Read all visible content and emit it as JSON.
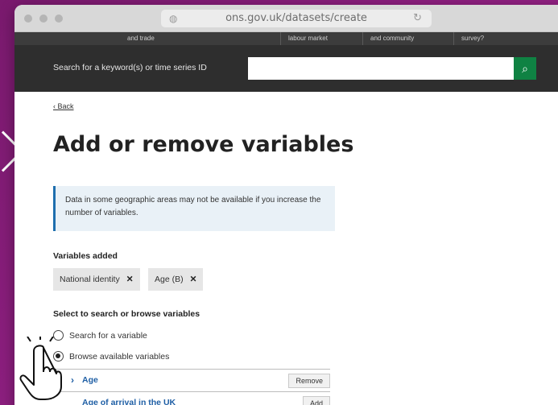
{
  "browser": {
    "url": "ons.gov.uk/datasets/create"
  },
  "topnav": {
    "items": [
      "and trade",
      "labour market",
      "and community",
      "survey?"
    ]
  },
  "search": {
    "label": "Search for a keyword(s) or time series ID",
    "placeholder": "",
    "button_icon": "search-icon"
  },
  "page": {
    "back_label": "Back",
    "title": "Add or remove variables",
    "notice": "Data in some geographic areas may not be available if you increase the number of variables.",
    "variables_added_heading": "Variables added",
    "chips": [
      {
        "label": "National identity"
      },
      {
        "label": "Age (B)"
      }
    ],
    "select_heading": "Select to search or browse variables",
    "radio_options": [
      {
        "label": "Search for a variable",
        "checked": false
      },
      {
        "label": "Browse available variables",
        "checked": true
      }
    ],
    "variable_rows": [
      {
        "label": "Age",
        "action": "Remove"
      },
      {
        "label": "Age of arrival in the UK",
        "action": "Add"
      }
    ]
  },
  "colors": {
    "background": "#8e1f80",
    "header": "#2e2e2e",
    "search_button": "#0f8243",
    "link": "#1f5fa5",
    "notice_border": "#1f6fae"
  }
}
